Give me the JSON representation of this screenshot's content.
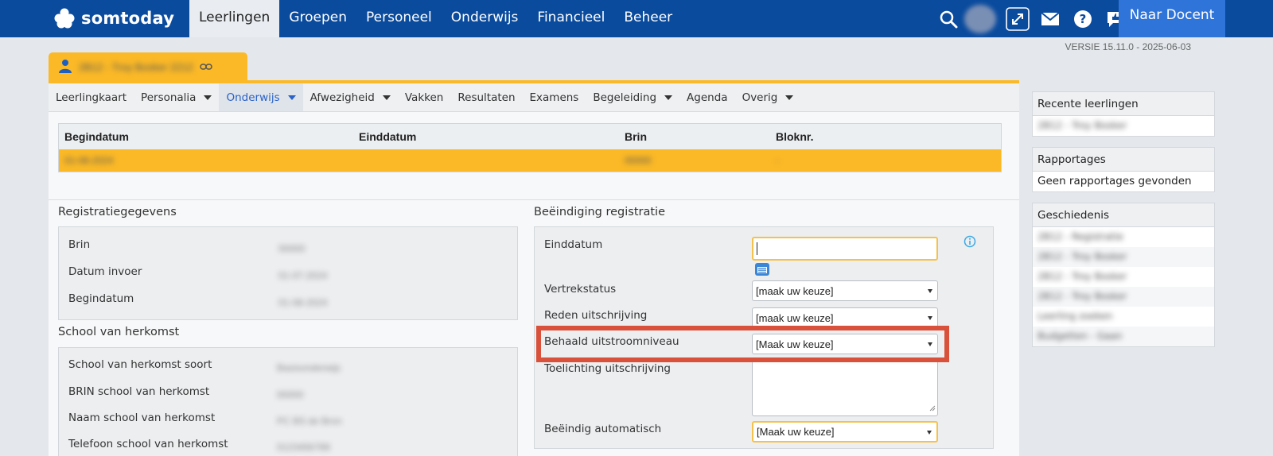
{
  "app": {
    "logo_text": "somtoday",
    "version": "VERSIE 15.11.0 - 2025-06-03",
    "naar_docent_label": "Naar Docent",
    "top_nav": [
      {
        "label": "Leerlingen",
        "active": true
      },
      {
        "label": "Groepen",
        "active": false
      },
      {
        "label": "Personeel",
        "active": false
      },
      {
        "label": "Onderwijs",
        "active": false
      },
      {
        "label": "Financieel",
        "active": false
      },
      {
        "label": "Beheer",
        "active": false
      }
    ],
    "top_icons": [
      "search-icon",
      "fullscreen-icon",
      "mail-icon",
      "help-icon",
      "feedback-icon",
      "power-icon",
      "settings-icon"
    ]
  },
  "student": {
    "name_blurred": "2B12 - Troy Bosker 2212"
  },
  "subnav": [
    {
      "label": "Leerlingkaart",
      "dropdown": false,
      "active": false
    },
    {
      "label": "Personalia",
      "dropdown": true,
      "active": false
    },
    {
      "label": "Onderwijs",
      "dropdown": true,
      "active": true
    },
    {
      "label": "Afwezigheid",
      "dropdown": true,
      "active": false
    },
    {
      "label": "Vakken",
      "dropdown": false,
      "active": false
    },
    {
      "label": "Resultaten",
      "dropdown": false,
      "active": false
    },
    {
      "label": "Examens",
      "dropdown": false,
      "active": false
    },
    {
      "label": "Begeleiding",
      "dropdown": true,
      "active": false
    },
    {
      "label": "Agenda",
      "dropdown": false,
      "active": false
    },
    {
      "label": "Overig",
      "dropdown": true,
      "active": false
    }
  ],
  "table": {
    "headers": [
      "Begindatum",
      "Einddatum",
      "Brin",
      "Bloknr."
    ],
    "rows": [
      {
        "begindatum": "01-08-2024",
        "einddatum": "",
        "brin": "00000",
        "bloknr": "-"
      }
    ]
  },
  "registratie": {
    "title": "Registratiegegevens",
    "fields": [
      {
        "label": "Brin",
        "value": "00000"
      },
      {
        "label": "Datum invoer",
        "value": "01-07-2024"
      },
      {
        "label": "Begindatum",
        "value": "01-08-2024"
      }
    ]
  },
  "herkomst": {
    "title": "School van herkomst",
    "fields": [
      {
        "label": "School van herkomst soort",
        "value": "Basisonderwijs"
      },
      {
        "label": "BRIN school van herkomst",
        "value": "00000"
      },
      {
        "label": "Naam school van herkomst",
        "value": "PC BS de Bron"
      },
      {
        "label": "Telefoon school van herkomst",
        "value": "0123456789"
      }
    ]
  },
  "beeindiging": {
    "title": "Beëindiging registratie",
    "einddatum_label": "Einddatum",
    "einddatum_value": "",
    "vertrekstatus_label": "Vertrekstatus",
    "vertrekstatus_value": "[maak uw keuze]",
    "reden_label": "Reden uitschrijving",
    "reden_value": "[maak uw keuze]",
    "uitstroom_label": "Behaald uitstroomniveau",
    "uitstroom_value": "[Maak uw keuze]",
    "toelichting_label": "Toelichting uitschrijving",
    "toelichting_value": "",
    "automatisch_label": "Beëindig automatisch",
    "automatisch_value": "[Maak uw keuze]"
  },
  "sidebar": {
    "recent_title": "Recente leerlingen",
    "recent_items": [
      "2B12 - Troy Bosker"
    ],
    "rapportages_title": "Rapportages",
    "rapportages_empty": "Geen rapportages gevonden",
    "geschiedenis_title": "Geschiedenis",
    "geschiedenis_items": [
      "2B12 - Registratie",
      "2B12 - Troy Bosker",
      "2B12 - Troy Bosker",
      "2B12 - Troy Bosker",
      "Leerling zoeken",
      "Budgetten - Gaan"
    ]
  },
  "colors": {
    "topbar": "#0a4b9e",
    "accent": "#fbb927",
    "highlight": "#d9513a",
    "button": "#2f74d9"
  }
}
